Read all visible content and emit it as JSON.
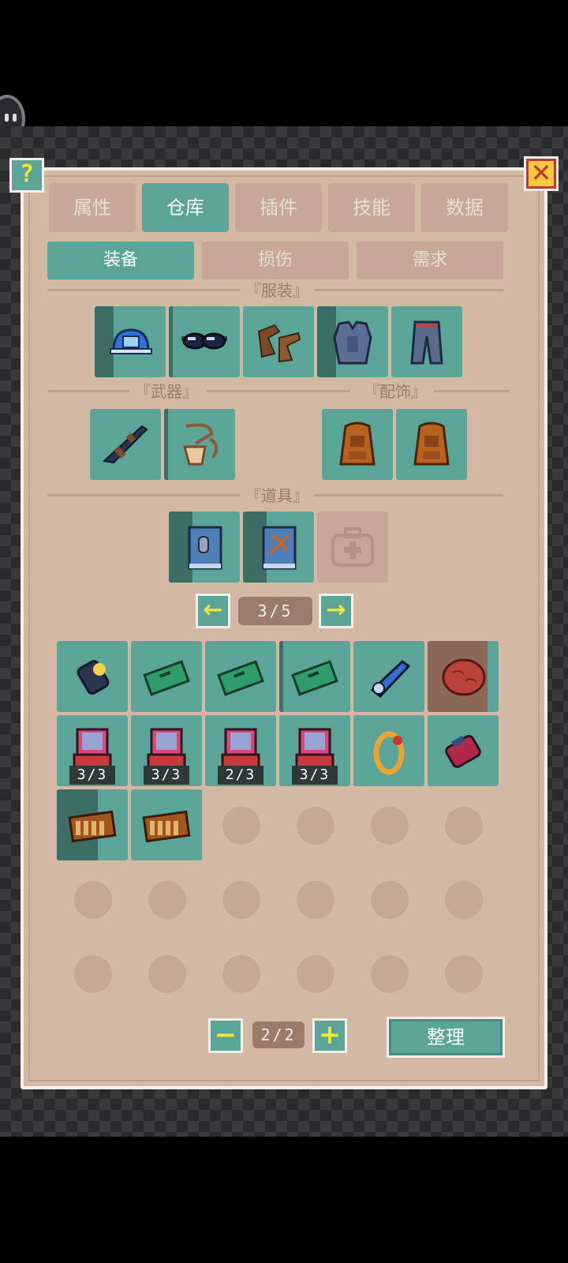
{
  "help": {
    "label": "?"
  },
  "close": {
    "label": "✕"
  },
  "tabs": [
    {
      "label": "属性",
      "active": false
    },
    {
      "label": "仓库",
      "active": true
    },
    {
      "label": "插件",
      "active": false
    },
    {
      "label": "技能",
      "active": false
    },
    {
      "label": "数据",
      "active": false
    }
  ],
  "subtabs": [
    {
      "label": "装备",
      "active": true
    },
    {
      "label": "损伤",
      "active": false
    },
    {
      "label": "需求",
      "active": false
    }
  ],
  "sections": {
    "clothing": "『服装』",
    "weapons": "『武器』",
    "accessories": "『配饰』",
    "items": "『道具』"
  },
  "equipped": {
    "clothing": [
      "blue-helmet-icon",
      "goggles-icon",
      "boots-icon",
      "armor-vest-icon",
      "pants-icon"
    ],
    "weapons": [
      "rifle-icon",
      "sling-bag-icon"
    ],
    "accessories": [
      "backpack-icon",
      "backpack-icon"
    ],
    "items": [
      "ammo-book-icon",
      "crossbow-book-icon",
      "medkit-placeholder-icon"
    ]
  },
  "inventory_pager": {
    "label": "3/5",
    "prev": "←",
    "next": "→"
  },
  "inventory": [
    {
      "icon": "lantern-icon",
      "count": ""
    },
    {
      "icon": "bandage-box-icon",
      "count": ""
    },
    {
      "icon": "bandage-box-icon",
      "count": ""
    },
    {
      "icon": "bandage-box-icon",
      "count": ""
    },
    {
      "icon": "chainsaw-icon",
      "count": ""
    },
    {
      "icon": "meat-icon",
      "count": ""
    },
    {
      "icon": "tablet-icon",
      "count": "3/3"
    },
    {
      "icon": "tablet-icon",
      "count": "3/3"
    },
    {
      "icon": "tablet-icon",
      "count": "2/3"
    },
    {
      "icon": "tablet-icon",
      "count": "3/3"
    },
    {
      "icon": "ring-icon",
      "count": ""
    },
    {
      "icon": "grenade-icon",
      "count": ""
    },
    {
      "icon": "ammo-belt-icon",
      "count": ""
    },
    {
      "icon": "ammo-belt-icon",
      "count": ""
    }
  ],
  "storage_pager": {
    "label": "2/2",
    "minus": "−",
    "plus": "+"
  },
  "sort": {
    "label": "整理"
  },
  "colors": {
    "accent": "#5aa597",
    "panel": "#d3b8a3",
    "tab_inactive": "#c7a898",
    "yellow": "#f4e43b"
  }
}
